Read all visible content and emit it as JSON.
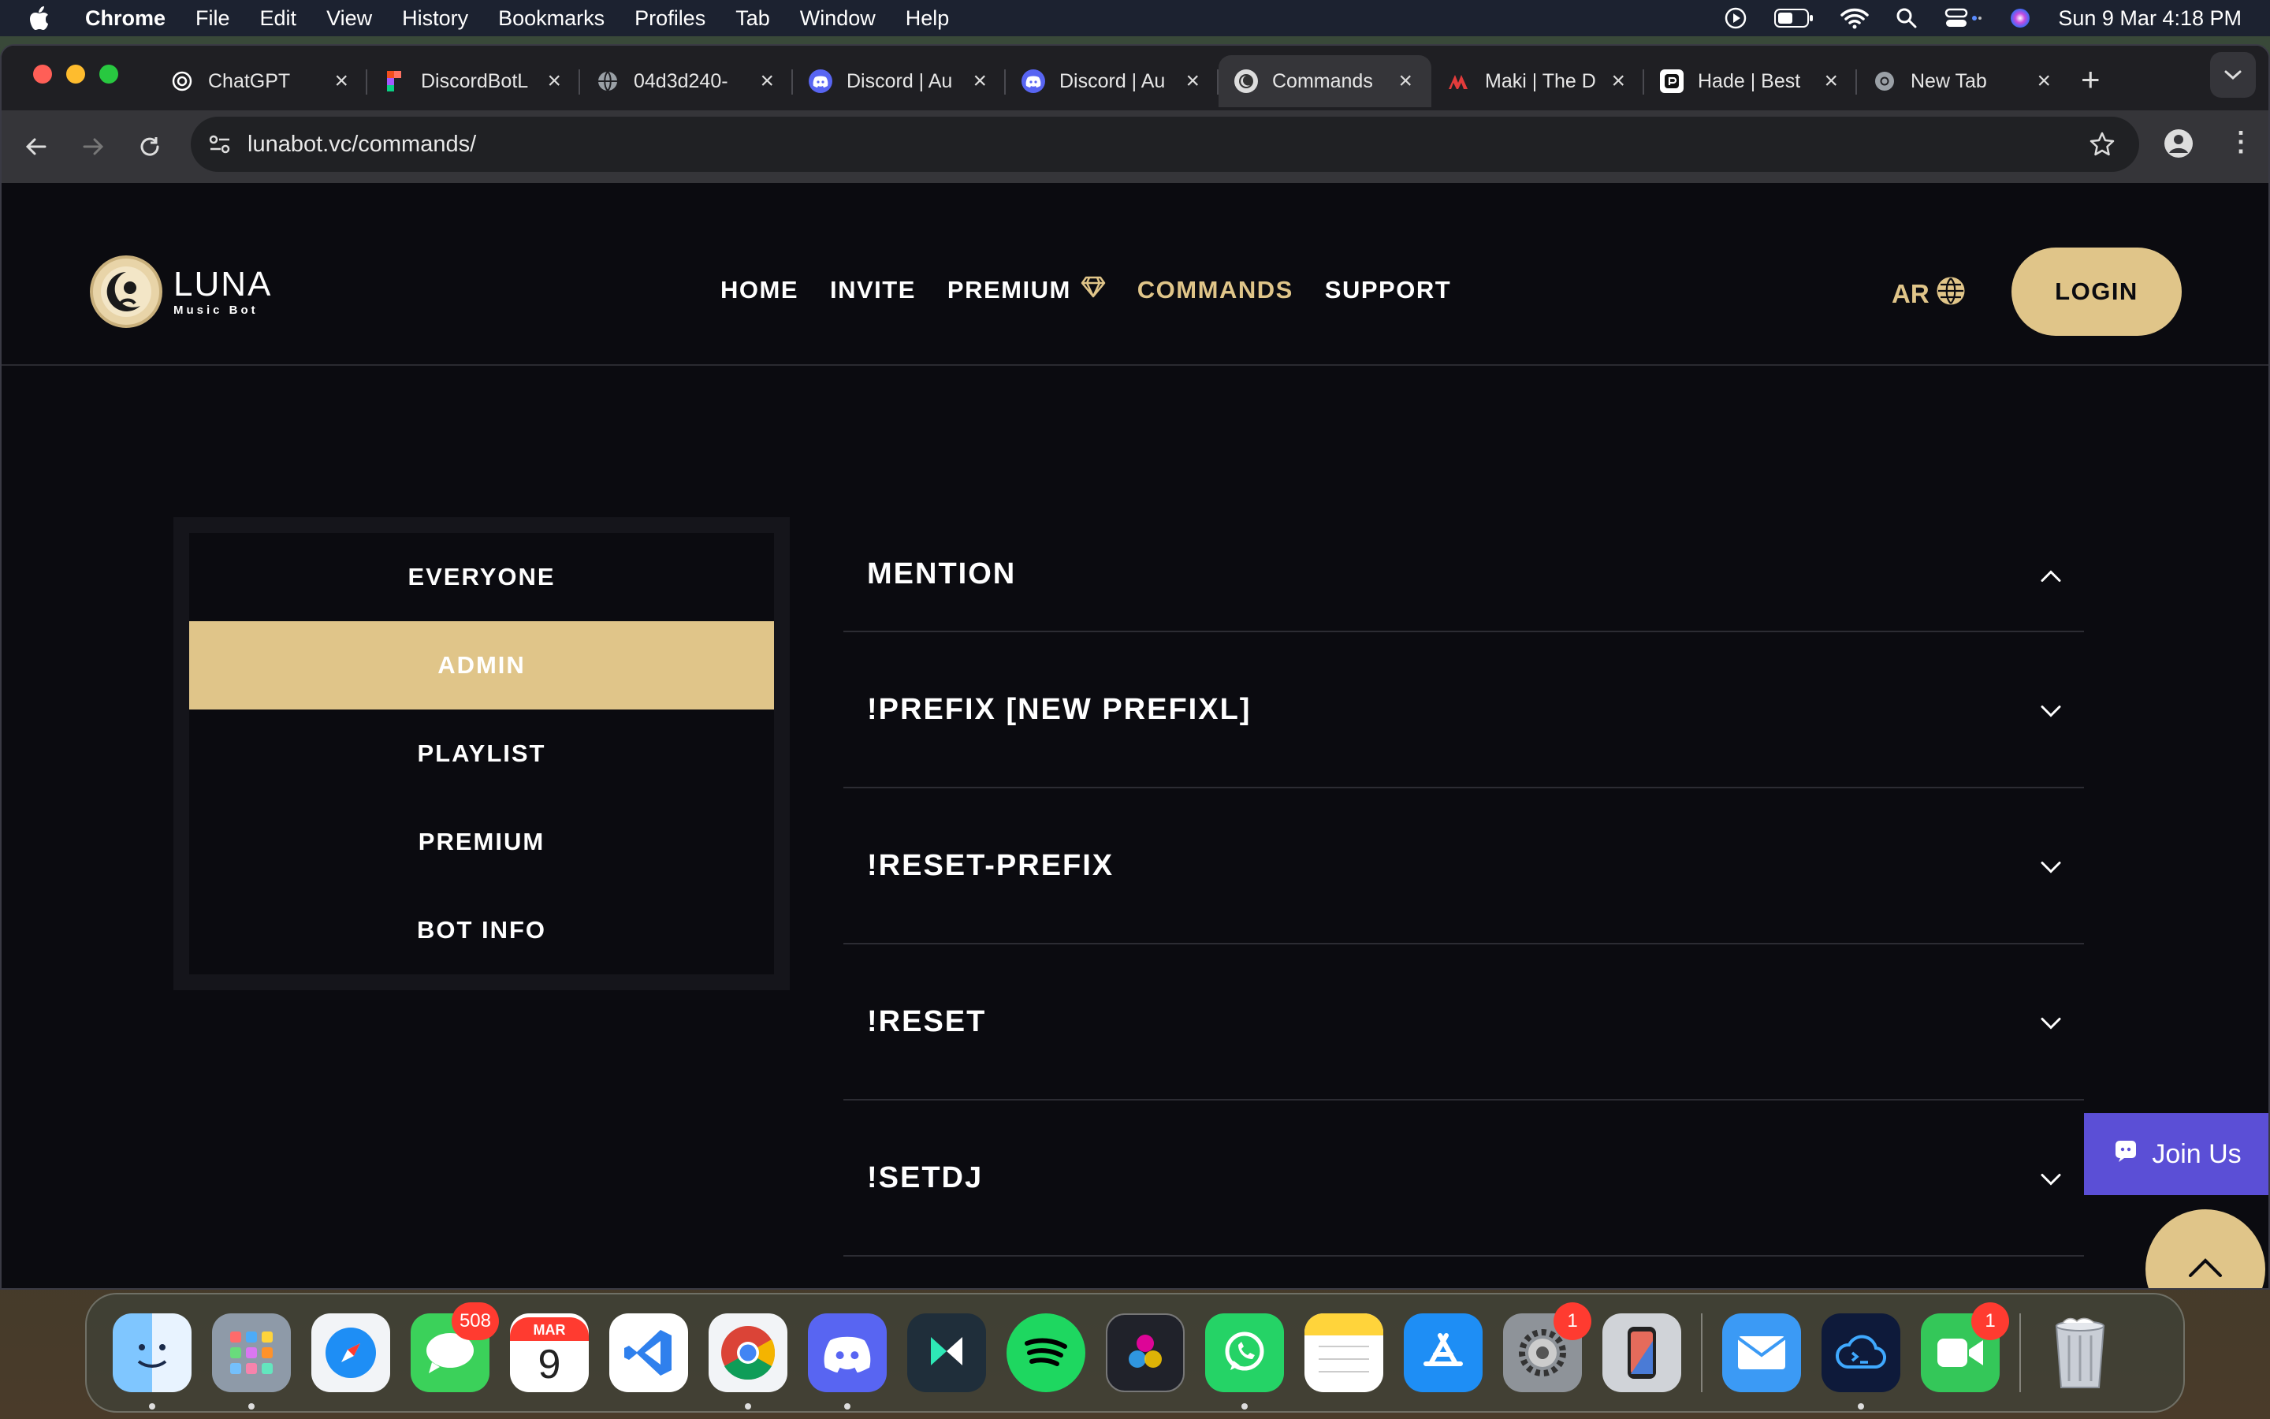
{
  "menubar": {
    "app": "Chrome",
    "items": [
      "File",
      "Edit",
      "View",
      "History",
      "Bookmarks",
      "Profiles",
      "Tab",
      "Window",
      "Help"
    ],
    "clock": "Sun 9 Mar  4:18 PM"
  },
  "tabs": [
    {
      "title": "ChatGPT",
      "icon": "openai-icon",
      "color": "#ffffff"
    },
    {
      "title": "DiscordBotL",
      "icon": "figma-icon",
      "color": "#f24e1e"
    },
    {
      "title": "04d3d240-",
      "icon": "globe-icon",
      "color": "#9aa0a6"
    },
    {
      "title": "Discord | Au",
      "icon": "discord-icon",
      "color": "#5865f2"
    },
    {
      "title": "Discord | Au",
      "icon": "discord-icon",
      "color": "#5865f2"
    },
    {
      "title": "Commands",
      "icon": "luna-icon",
      "color": "#cccccc",
      "active": true
    },
    {
      "title": "Maki | The D",
      "icon": "maki-icon",
      "color": "#e23b3b"
    },
    {
      "title": "Hade | Best",
      "icon": "hade-icon",
      "color": "#111111"
    },
    {
      "title": "New Tab",
      "icon": "chrome-icon",
      "color": "#9aa0a6"
    }
  ],
  "address_bar": {
    "url": "lunabot.vc/commands/"
  },
  "site": {
    "logo_name": "LUNA",
    "logo_tag": "Music Bot",
    "nav": {
      "home": "HOME",
      "invite": "INVITE",
      "premium": "PREMIUM",
      "commands": "COMMANDS",
      "support": "SUPPORT"
    },
    "lang": "AR",
    "login": "LOGIN"
  },
  "categories": [
    {
      "label": "EVERYONE"
    },
    {
      "label": "ADMIN",
      "active": true
    },
    {
      "label": "PLAYLIST"
    },
    {
      "label": "PREMIUM"
    },
    {
      "label": "BOT INFO"
    }
  ],
  "commands": [
    {
      "name": "MENTION",
      "expanded": true
    },
    {
      "name": "!PREFIX [NEW PREFIXL]",
      "expanded": false
    },
    {
      "name": "!RESET-PREFIX",
      "expanded": false
    },
    {
      "name": "!RESET",
      "expanded": false
    },
    {
      "name": "!SETDJ",
      "expanded": false
    }
  ],
  "join_us": "Join Us",
  "dock": {
    "apps": [
      "Finder",
      "Launchpad",
      "Safari",
      "Messages",
      "Calendar",
      "VS Code",
      "Chrome",
      "Discord",
      "Filmora",
      "Spotify",
      "DaVinci Resolve",
      "WhatsApp",
      "Notes",
      "App Store",
      "System Settings",
      "iPhone Mirroring",
      "Mail",
      "Terminal",
      "FaceTime",
      "Trash"
    ],
    "messages_badge": "508",
    "settings_badge": "1",
    "facetime_badge": "1",
    "calendar_month": "MAR",
    "calendar_day": "9"
  },
  "colors": {
    "accent": "#e0c589",
    "background": "#0b0b10",
    "join": "#5b4fd6"
  }
}
